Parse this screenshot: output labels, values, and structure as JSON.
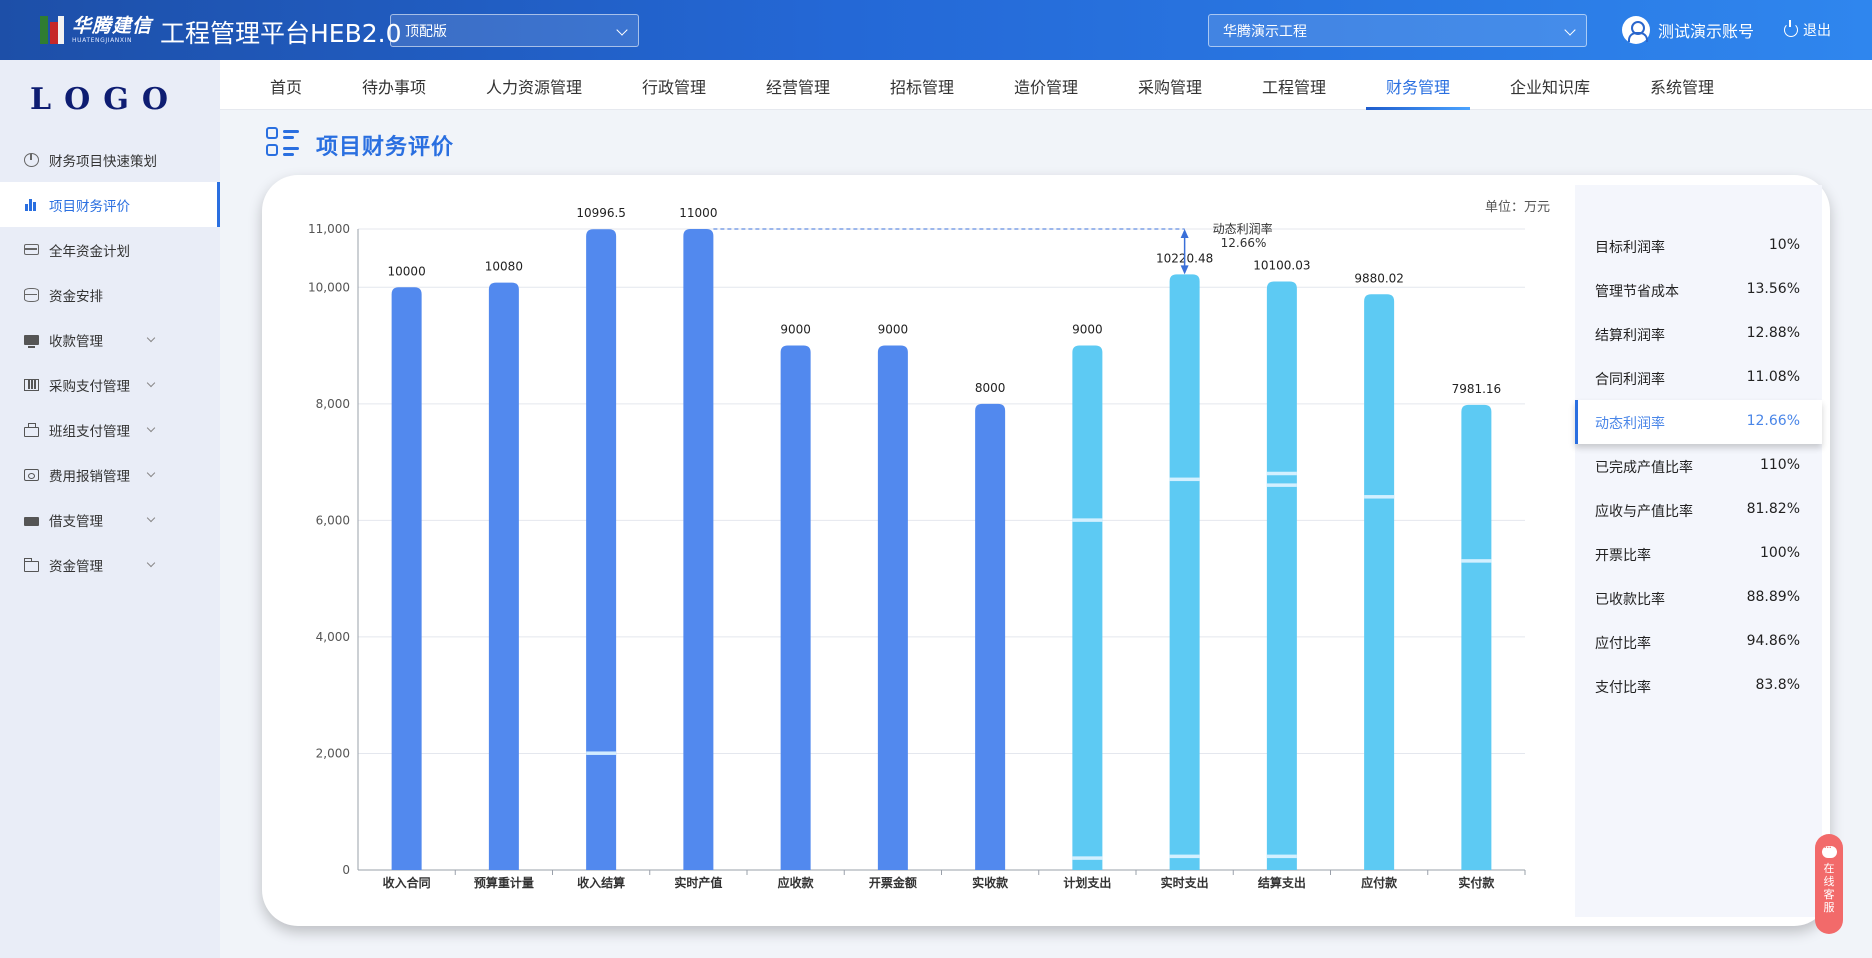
{
  "header": {
    "brand_cn": "华腾建信",
    "brand_en": "HUATENGJIANXIN",
    "app_title": "工程管理平台HEB2.0",
    "version_select": "顶配版",
    "project_select": "华腾演示工程",
    "account": "测试演示账号",
    "logout": "退出"
  },
  "sidebar": {
    "logo": "LOGO",
    "items": [
      {
        "label": "财务项目快速策划",
        "icon": "pie-chart-icon"
      },
      {
        "label": "项目财务评价",
        "icon": "bar-chart-icon",
        "active": true
      },
      {
        "label": "全年资金计划",
        "icon": "credit-card-icon"
      },
      {
        "label": "资金安排",
        "icon": "database-icon"
      },
      {
        "label": "收款管理",
        "icon": "monitor-icon"
      },
      {
        "label": "采购支付管理",
        "icon": "shelf-icon"
      },
      {
        "label": "班组支付管理",
        "icon": "briefcase-icon"
      },
      {
        "label": "费用报销管理",
        "icon": "receipt-icon"
      },
      {
        "label": "借支管理",
        "icon": "loan-icon"
      },
      {
        "label": "资金管理",
        "icon": "folder-icon"
      }
    ]
  },
  "topnav": {
    "items": [
      "首页",
      "待办事项",
      "人力资源管理",
      "行政管理",
      "经营管理",
      "招标管理",
      "造价管理",
      "采购管理",
      "工程管理",
      "财务管理",
      "企业知识库",
      "系统管理"
    ],
    "active": "财务管理"
  },
  "page": {
    "title": "项目财务评价",
    "unit": "单位：万元"
  },
  "chart_data": {
    "type": "bar",
    "categories": [
      "收入合同",
      "预算重计量",
      "收入结算",
      "实时产值",
      "应收款",
      "开票金额",
      "实收款",
      "计划支出",
      "实时支出",
      "结算支出",
      "应付款",
      "实付款"
    ],
    "values": [
      10000,
      10080,
      10996.5,
      11000,
      9000,
      9000,
      8000,
      9000,
      10220.48,
      10100.03,
      9880.02,
      7981.16
    ],
    "value_labels": [
      "10000",
      "10080",
      "10996.5",
      "11000",
      "9000",
      "9000",
      "8000",
      "9000",
      "10220.48",
      "10100.03",
      "9880.02",
      "7981.16"
    ],
    "series_colors": [
      "#5289ee",
      "#5289ee",
      "#5289ee",
      "#5289ee",
      "#5289ee",
      "#5289ee",
      "#5289ee",
      "#5dcaf3",
      "#5dcaf3",
      "#5dcaf3",
      "#5dcaf3",
      "#5dcaf3"
    ],
    "segment_marks": [
      [],
      [],
      [
        2000
      ],
      [],
      [],
      [],
      [],
      [
        6000,
        200
      ],
      [
        6700,
        230
      ],
      [
        6800,
        6600,
        230
      ],
      [
        6400
      ],
      [
        5300
      ]
    ],
    "yticks": [
      0,
      2000,
      4000,
      6000,
      8000,
      10000,
      11000
    ],
    "ytick_labels": [
      "0",
      "2,000",
      "4,000",
      "6,000",
      "8,000",
      "10,000",
      "11,000"
    ],
    "ylim": [
      0,
      11000
    ],
    "grid": true,
    "annotation": {
      "label": "动态利润率",
      "value": "12.66%",
      "from": 10220.48,
      "to": 11000,
      "category": "实时支出"
    },
    "title": "",
    "xlabel": "",
    "ylabel": ""
  },
  "kpis": [
    {
      "label": "目标利润率",
      "value": "10%"
    },
    {
      "label": "管理节省成本",
      "value": "13.56%"
    },
    {
      "label": "结算利润率",
      "value": "12.88%"
    },
    {
      "label": "合同利润率",
      "value": "11.08%"
    },
    {
      "label": "动态利润率",
      "value": "12.66%",
      "active": true
    },
    {
      "label": "已完成产值比率",
      "value": "110%"
    },
    {
      "label": "应收与产值比率",
      "value": "81.82%"
    },
    {
      "label": "开票比率",
      "value": "100%"
    },
    {
      "label": "已收款比率",
      "value": "88.89%"
    },
    {
      "label": "应付比率",
      "value": "94.86%"
    },
    {
      "label": "支付比率",
      "value": "83.8%"
    }
  ],
  "service": {
    "chars": [
      "在",
      "线",
      "客",
      "服"
    ]
  }
}
